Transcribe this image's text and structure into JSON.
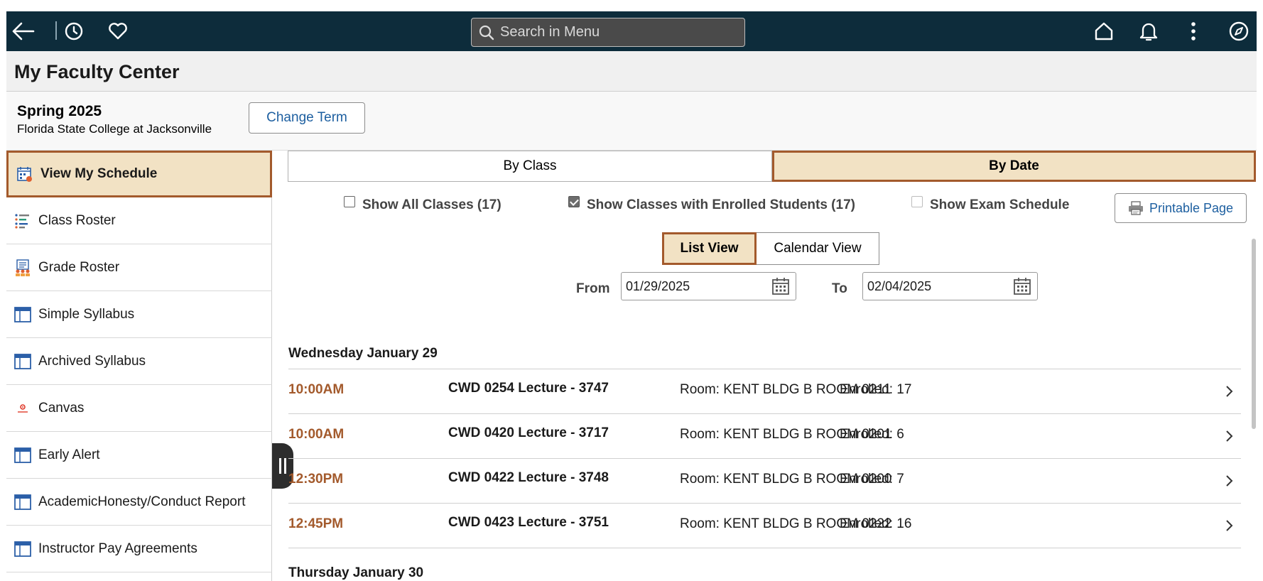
{
  "topbar": {
    "search_placeholder": "Search in Menu",
    "bg_color": "#0d2c3b"
  },
  "header": {
    "title": "My Faculty Center"
  },
  "term": {
    "name": "Spring 2025",
    "school": "Florida State College at Jacksonville",
    "change_label": "Change Term"
  },
  "sidebar": {
    "items": [
      {
        "label": "View My Schedule",
        "icon": "calendar-schedule-icon",
        "active": true
      },
      {
        "label": "Class Roster",
        "icon": "roster-list-icon"
      },
      {
        "label": "Grade Roster",
        "icon": "grade-roster-icon"
      },
      {
        "label": "Simple Syllabus",
        "icon": "window-icon"
      },
      {
        "label": "Archived Syllabus",
        "icon": "window-icon"
      },
      {
        "label": "Canvas",
        "icon": "canvas-logo-icon"
      },
      {
        "label": "Early Alert",
        "icon": "window-icon"
      },
      {
        "label": "AcademicHonesty/Conduct Report",
        "icon": "window-icon"
      },
      {
        "label": "Instructor Pay Agreements",
        "icon": "window-icon"
      }
    ]
  },
  "tabs": {
    "by_class": "By Class",
    "by_date": "By Date"
  },
  "filters": {
    "show_all": "Show All Classes (17)",
    "show_enrolled": "Show Classes with Enrolled Students (17)",
    "show_exam": "Show Exam Schedule",
    "printable": "Printable Page"
  },
  "view": {
    "list": "List View",
    "calendar": "Calendar View"
  },
  "dates": {
    "from_label": "From",
    "from_value": "01/29/2025",
    "to_label": "To",
    "to_value": "02/04/2025"
  },
  "schedule": {
    "days": [
      {
        "heading": "Wednesday January 29",
        "classes": [
          {
            "time": "10:00AM",
            "course": "CWD 0254 Lecture - 3747",
            "room": "Room: KENT BLDG B ROOM 0211",
            "enrolled": "Enrolled: 17"
          },
          {
            "time": "10:00AM",
            "course": "CWD 0420 Lecture - 3717",
            "room": "Room: KENT BLDG B ROOM 0201",
            "enrolled": "Enrolled: 6"
          },
          {
            "time": "12:30PM",
            "course": "CWD 0422 Lecture - 3748",
            "room": "Room: KENT BLDG B ROOM 0200",
            "enrolled": "Enrolled: 7"
          },
          {
            "time": "12:45PM",
            "course": "CWD 0423 Lecture - 3751",
            "room": "Room: KENT BLDG B ROOM 0222",
            "enrolled": "Enrolled: 16"
          }
        ]
      },
      {
        "heading": "Thursday January 30",
        "classes": []
      }
    ]
  },
  "colors": {
    "accent": "#a35a2c",
    "active_bg": "#f2e2c4",
    "link": "#1d5fa0"
  }
}
